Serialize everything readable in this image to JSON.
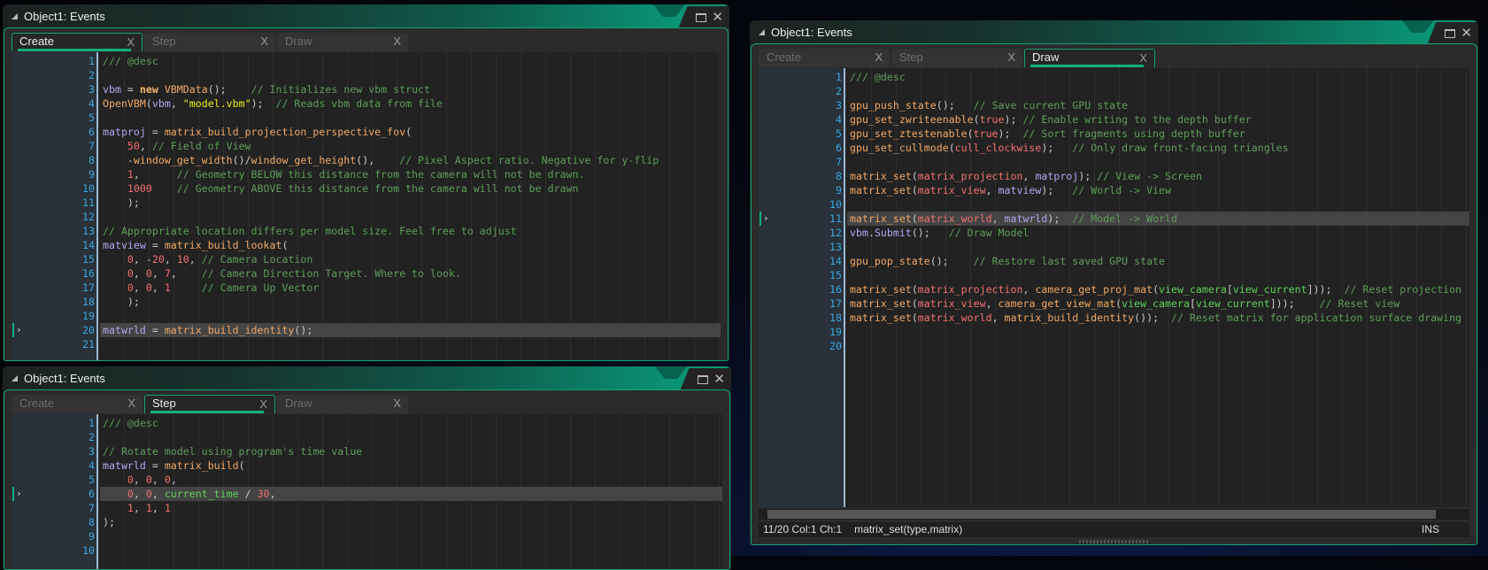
{
  "colors": {
    "accent": "#10a474",
    "comment": "#5f9c5a",
    "function": "#f0a866",
    "variable": "#b3a7f0",
    "constant": "#f07070",
    "string": "#ecec10",
    "builtin": "#5fd05a",
    "line_number": "#3aa8e0"
  },
  "windows": [
    {
      "title": "Object1: Events",
      "tabs": [
        {
          "label": "Create",
          "active": true
        },
        {
          "label": "Step",
          "active": false
        },
        {
          "label": "Draw",
          "active": false
        }
      ],
      "current_line": 20,
      "lines": [
        [
          [
            "/// @desc",
            "c"
          ]
        ],
        [],
        [
          [
            "vbm",
            "v"
          ],
          [
            " = ",
            "p"
          ],
          [
            "new",
            "k"
          ],
          [
            " ",
            "p"
          ],
          [
            "VBMData",
            "f"
          ],
          [
            "();    ",
            "p"
          ],
          [
            "// Initializes new vbm struct",
            "c"
          ]
        ],
        [
          [
            "OpenVBM",
            "f"
          ],
          [
            "(",
            "p"
          ],
          [
            "vbm",
            "v"
          ],
          [
            ", ",
            "p"
          ],
          [
            "\"model.vbm\"",
            "s"
          ],
          [
            ");  ",
            "p"
          ],
          [
            "// Reads vbm data from file",
            "c"
          ]
        ],
        [],
        [
          [
            "matproj",
            "v"
          ],
          [
            " = ",
            "p"
          ],
          [
            "matrix_build_projection_perspective_fov",
            "f"
          ],
          [
            "(",
            "p"
          ]
        ],
        [
          [
            "    ",
            "p"
          ],
          [
            "50",
            "n"
          ],
          [
            ", ",
            "p"
          ],
          [
            "// Field of View",
            "c"
          ]
        ],
        [
          [
            "    -",
            "p"
          ],
          [
            "window_get_width",
            "f"
          ],
          [
            "()/",
            "p"
          ],
          [
            "window_get_height",
            "f"
          ],
          [
            "(),    ",
            "p"
          ],
          [
            "// Pixel Aspect ratio. Negative for y-flip",
            "c"
          ]
        ],
        [
          [
            "    ",
            "p"
          ],
          [
            "1",
            "n"
          ],
          [
            ",      ",
            "p"
          ],
          [
            "// Geometry BELOW this distance from the camera will not be drawn.",
            "c"
          ]
        ],
        [
          [
            "    ",
            "p"
          ],
          [
            "1000",
            "n"
          ],
          [
            "    ",
            "p"
          ],
          [
            "// Geometry ABOVE this distance from the camera will not be drawn",
            "c"
          ]
        ],
        [
          [
            "    );",
            "p"
          ]
        ],
        [],
        [
          [
            "// Appropriate location differs per model size. Feel free to adjust",
            "c"
          ]
        ],
        [
          [
            "matview",
            "v"
          ],
          [
            " = ",
            "p"
          ],
          [
            "matrix_build_lookat",
            "f"
          ],
          [
            "(",
            "p"
          ]
        ],
        [
          [
            "    ",
            "p"
          ],
          [
            "0",
            "n"
          ],
          [
            ", -",
            "p"
          ],
          [
            "20",
            "n"
          ],
          [
            ", ",
            "p"
          ],
          [
            "10",
            "n"
          ],
          [
            ", ",
            "p"
          ],
          [
            "// Camera Location",
            "c"
          ]
        ],
        [
          [
            "    ",
            "p"
          ],
          [
            "0",
            "n"
          ],
          [
            ", ",
            "p"
          ],
          [
            "0",
            "n"
          ],
          [
            ", ",
            "p"
          ],
          [
            "7",
            "n"
          ],
          [
            ",    ",
            "p"
          ],
          [
            "// Camera Direction Target. Where to look.",
            "c"
          ]
        ],
        [
          [
            "    ",
            "p"
          ],
          [
            "0",
            "n"
          ],
          [
            ", ",
            "p"
          ],
          [
            "0",
            "n"
          ],
          [
            ", ",
            "p"
          ],
          [
            "1",
            "n"
          ],
          [
            "     ",
            "p"
          ],
          [
            "// Camera Up Vector",
            "c"
          ]
        ],
        [
          [
            "    );",
            "p"
          ]
        ],
        [],
        [
          [
            "matwrld",
            "v"
          ],
          [
            " = ",
            "p"
          ],
          [
            "matrix_build_identity",
            "f"
          ],
          [
            "();",
            "p"
          ]
        ],
        []
      ]
    },
    {
      "title": "Object1: Events",
      "tabs": [
        {
          "label": "Create",
          "active": false
        },
        {
          "label": "Step",
          "active": false
        },
        {
          "label": "Draw",
          "active": true
        }
      ],
      "current_line": 11,
      "lines": [
        [
          [
            "/// @desc",
            "c"
          ]
        ],
        [],
        [
          [
            "gpu_push_state",
            "f"
          ],
          [
            "();   ",
            "p"
          ],
          [
            "// Save current GPU state",
            "c"
          ]
        ],
        [
          [
            "gpu_set_zwriteenable",
            "f"
          ],
          [
            "(",
            "p"
          ],
          [
            "true",
            "n"
          ],
          [
            "); ",
            "p"
          ],
          [
            "// Enable writing to the depth buffer",
            "c"
          ]
        ],
        [
          [
            "gpu_set_ztestenable",
            "f"
          ],
          [
            "(",
            "p"
          ],
          [
            "true",
            "n"
          ],
          [
            ");  ",
            "p"
          ],
          [
            "// Sort fragments using depth buffer",
            "c"
          ]
        ],
        [
          [
            "gpu_set_cullmode",
            "f"
          ],
          [
            "(",
            "p"
          ],
          [
            "cull_clockwise",
            "n"
          ],
          [
            ");   ",
            "p"
          ],
          [
            "// Only draw front-facing triangles",
            "c"
          ]
        ],
        [],
        [
          [
            "matrix_set",
            "f"
          ],
          [
            "(",
            "p"
          ],
          [
            "matrix_projection",
            "n"
          ],
          [
            ", ",
            "p"
          ],
          [
            "matproj",
            "v"
          ],
          [
            "); ",
            "p"
          ],
          [
            "// View -> Screen",
            "c"
          ]
        ],
        [
          [
            "matrix_set",
            "f"
          ],
          [
            "(",
            "p"
          ],
          [
            "matrix_view",
            "n"
          ],
          [
            ", ",
            "p"
          ],
          [
            "matview",
            "v"
          ],
          [
            ");   ",
            "p"
          ],
          [
            "// World -> View",
            "c"
          ]
        ],
        [],
        [
          [
            "matrix_set",
            "f"
          ],
          [
            "(",
            "p"
          ],
          [
            "matrix_world",
            "n"
          ],
          [
            ", ",
            "p"
          ],
          [
            "matwrld",
            "v"
          ],
          [
            ");  ",
            "p"
          ],
          [
            "// Model -> World",
            "c"
          ]
        ],
        [
          [
            "vbm",
            "v"
          ],
          [
            ".",
            "p"
          ],
          [
            "Submit",
            "v"
          ],
          [
            "();   ",
            "p"
          ],
          [
            "// Draw Model",
            "c"
          ]
        ],
        [],
        [
          [
            "gpu_pop_state",
            "f"
          ],
          [
            "();    ",
            "p"
          ],
          [
            "// Restore last saved GPU state",
            "c"
          ]
        ],
        [],
        [
          [
            "matrix_set",
            "f"
          ],
          [
            "(",
            "p"
          ],
          [
            "matrix_projection",
            "n"
          ],
          [
            ", ",
            "p"
          ],
          [
            "camera_get_proj_mat",
            "f"
          ],
          [
            "(",
            "p"
          ],
          [
            "view_camera",
            "b"
          ],
          [
            "[",
            "p"
          ],
          [
            "view_current",
            "b"
          ],
          [
            "]));  ",
            "p"
          ],
          [
            "// Reset projection",
            "c"
          ]
        ],
        [
          [
            "matrix_set",
            "f"
          ],
          [
            "(",
            "p"
          ],
          [
            "matrix_view",
            "n"
          ],
          [
            ", ",
            "p"
          ],
          [
            "camera_get_view_mat",
            "f"
          ],
          [
            "(",
            "p"
          ],
          [
            "view_camera",
            "b"
          ],
          [
            "[",
            "p"
          ],
          [
            "view_current",
            "b"
          ],
          [
            "]));    ",
            "p"
          ],
          [
            "// Reset view",
            "c"
          ]
        ],
        [
          [
            "matrix_set",
            "f"
          ],
          [
            "(",
            "p"
          ],
          [
            "matrix_world",
            "n"
          ],
          [
            ", ",
            "p"
          ],
          [
            "matrix_build_identity",
            "f"
          ],
          [
            "());  ",
            "p"
          ],
          [
            "// Reset matrix for application surface drawing",
            "c"
          ]
        ],
        [],
        []
      ],
      "status": {
        "position": "11/20 Col:1 Ch:1",
        "hint": "matrix_set(type,matrix)",
        "mode": "INS"
      }
    },
    {
      "title": "Object1: Events",
      "tabs": [
        {
          "label": "Create",
          "active": false
        },
        {
          "label": "Step",
          "active": true
        },
        {
          "label": "Draw",
          "active": false
        }
      ],
      "current_line": 6,
      "lines": [
        [
          [
            "/// @desc",
            "c"
          ]
        ],
        [],
        [
          [
            "// Rotate model using program's time value",
            "c"
          ]
        ],
        [
          [
            "matwrld",
            "v"
          ],
          [
            " = ",
            "p"
          ],
          [
            "matrix_build",
            "f"
          ],
          [
            "(",
            "p"
          ]
        ],
        [
          [
            "    ",
            "p"
          ],
          [
            "0",
            "n"
          ],
          [
            ", ",
            "p"
          ],
          [
            "0",
            "n"
          ],
          [
            ", ",
            "p"
          ],
          [
            "0",
            "n"
          ],
          [
            ",",
            "p"
          ]
        ],
        [
          [
            "    ",
            "p"
          ],
          [
            "0",
            "n"
          ],
          [
            ", ",
            "p"
          ],
          [
            "0",
            "n"
          ],
          [
            ", ",
            "p"
          ],
          [
            "current_time",
            "b"
          ],
          [
            " / ",
            "p"
          ],
          [
            "30",
            "n"
          ],
          [
            ",",
            "p"
          ]
        ],
        [
          [
            "    ",
            "p"
          ],
          [
            "1",
            "n"
          ],
          [
            ", ",
            "p"
          ],
          [
            "1",
            "n"
          ],
          [
            ", ",
            "p"
          ],
          [
            "1",
            "n"
          ]
        ],
        [
          [
            ");",
            "p"
          ]
        ],
        [],
        []
      ]
    }
  ]
}
